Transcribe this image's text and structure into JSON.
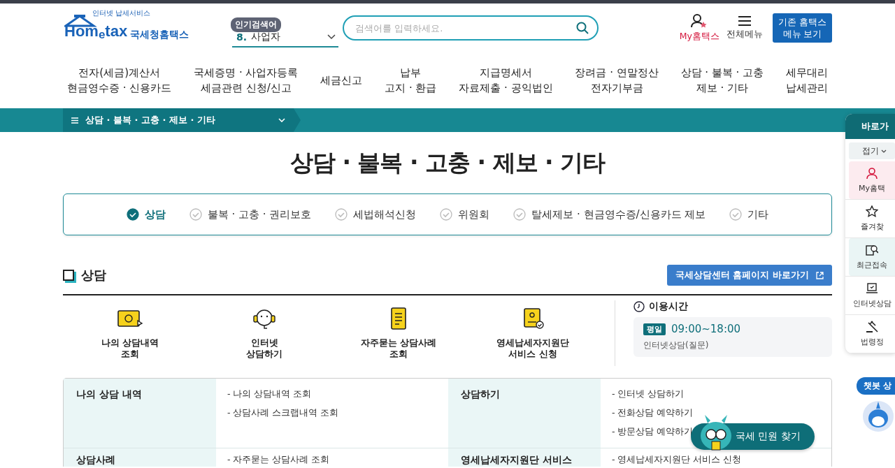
{
  "header": {
    "logo_caption": "인터넷 납세서비스",
    "logo_text": "Hom$_{e}$tax",
    "logo_name": "국세청홈택스",
    "popular_label": "인기검색어",
    "popular_rank": "8.",
    "popular_term": "사업자",
    "search_placeholder": "검색어를 입력하세요.",
    "my_label": "My홈택스",
    "menu_label": "전체메뉴",
    "legacy_button": "기존 홈택스\n메뉴 보기"
  },
  "nav": [
    "전자(세금)계산서\n현금영수증 · 신용카드",
    "국세증명 · 사업자등록\n세금관련 신청/신고",
    "세금신고",
    "납부\n고지 · 환급",
    "지급명세서\n자료제출 · 공익법인",
    "장려금 · 연말정산\n전자기부금",
    "상담 · 불복 · 고충\n제보 · 기타",
    "세무대리\n납세관리"
  ],
  "breadcrumb": "상담 · 불복 · 고충 · 제보 · 기타",
  "page_title": "상담 · 불복 · 고충 · 제보 · 기타",
  "tabs": [
    {
      "label": "상담",
      "selected": true
    },
    {
      "label": "불복 · 고충 · 권리보호",
      "selected": false
    },
    {
      "label": "세법해석신청",
      "selected": false
    },
    {
      "label": "위원회",
      "selected": false
    },
    {
      "label": "탈세제보 · 현금영수증/신용카드 제보",
      "selected": false
    },
    {
      "label": "기타",
      "selected": false
    }
  ],
  "section": {
    "title": "상담",
    "link_button": "국세상담센터 홈페이지 바로가기"
  },
  "services": [
    "나의 상담내역\n조회",
    "인터넷\n상담하기",
    "자주묻는 상담사례\n조회",
    "영세납세자지원단\n서비스 신청"
  ],
  "hours": {
    "title": "이용시간",
    "badge": "평일",
    "time": "09:00~18:00",
    "note": "인터넷상담(질문)"
  },
  "table": [
    {
      "heading": "나의 상담 내역",
      "links": [
        "- 나의 상담내역 조회",
        "- 상담사례 스크랩내역 조회"
      ]
    },
    {
      "heading": "상담하기",
      "links": [
        "- 인터넷 상담하기",
        "- 전화상담 예약하기",
        "- 방문상담 예약하기"
      ]
    },
    {
      "heading": "상담사례",
      "links": [
        "- 자주묻는 상담사례 조회"
      ]
    },
    {
      "heading": "영세납세자지원단 서비스",
      "links": [
        "- 영세납세자지원단 서비스 신청"
      ]
    }
  ],
  "quick": {
    "title": "바로가",
    "toggle": "접기",
    "items": [
      {
        "label": "My홈택",
        "color": "#fcebef"
      },
      {
        "label": "즐겨찾",
        "color": "#ffffff"
      },
      {
        "label": "최근접속",
        "color": "#eaf5f5"
      },
      {
        "label": "인터넷상담",
        "color": "#ffffff"
      },
      {
        "label": "법령정",
        "color": "#ffffff"
      }
    ]
  },
  "chatbot": "챗봇 상",
  "float_button": "국세 민원 찾기"
}
